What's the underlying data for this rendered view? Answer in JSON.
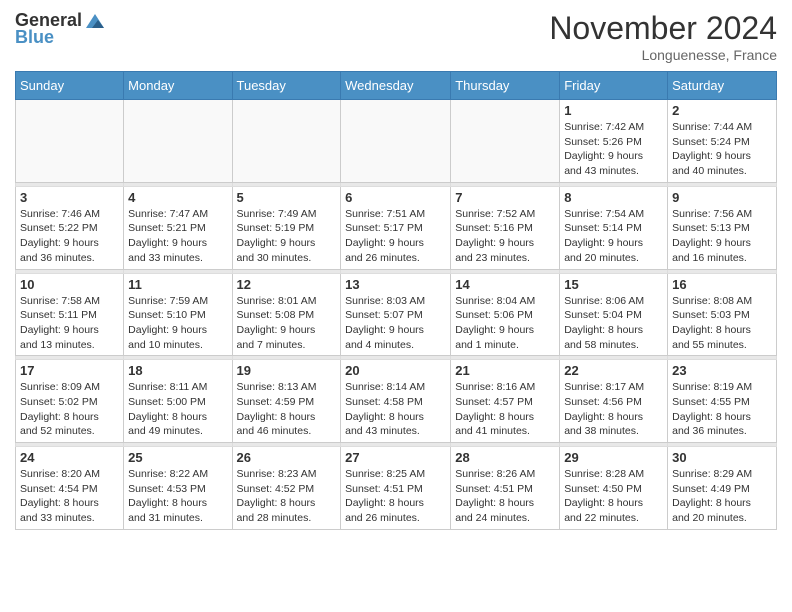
{
  "header": {
    "logo_line1": "General",
    "logo_line2": "Blue",
    "month": "November 2024",
    "location": "Longuenesse, France"
  },
  "days_of_week": [
    "Sunday",
    "Monday",
    "Tuesday",
    "Wednesday",
    "Thursday",
    "Friday",
    "Saturday"
  ],
  "weeks": [
    {
      "days": [
        {
          "num": "",
          "info": "",
          "empty": true
        },
        {
          "num": "",
          "info": "",
          "empty": true
        },
        {
          "num": "",
          "info": "",
          "empty": true
        },
        {
          "num": "",
          "info": "",
          "empty": true
        },
        {
          "num": "",
          "info": "",
          "empty": true
        },
        {
          "num": "1",
          "info": "Sunrise: 7:42 AM\nSunset: 5:26 PM\nDaylight: 9 hours\nand 43 minutes."
        },
        {
          "num": "2",
          "info": "Sunrise: 7:44 AM\nSunset: 5:24 PM\nDaylight: 9 hours\nand 40 minutes."
        }
      ]
    },
    {
      "days": [
        {
          "num": "3",
          "info": "Sunrise: 7:46 AM\nSunset: 5:22 PM\nDaylight: 9 hours\nand 36 minutes."
        },
        {
          "num": "4",
          "info": "Sunrise: 7:47 AM\nSunset: 5:21 PM\nDaylight: 9 hours\nand 33 minutes."
        },
        {
          "num": "5",
          "info": "Sunrise: 7:49 AM\nSunset: 5:19 PM\nDaylight: 9 hours\nand 30 minutes."
        },
        {
          "num": "6",
          "info": "Sunrise: 7:51 AM\nSunset: 5:17 PM\nDaylight: 9 hours\nand 26 minutes."
        },
        {
          "num": "7",
          "info": "Sunrise: 7:52 AM\nSunset: 5:16 PM\nDaylight: 9 hours\nand 23 minutes."
        },
        {
          "num": "8",
          "info": "Sunrise: 7:54 AM\nSunset: 5:14 PM\nDaylight: 9 hours\nand 20 minutes."
        },
        {
          "num": "9",
          "info": "Sunrise: 7:56 AM\nSunset: 5:13 PM\nDaylight: 9 hours\nand 16 minutes."
        }
      ]
    },
    {
      "days": [
        {
          "num": "10",
          "info": "Sunrise: 7:58 AM\nSunset: 5:11 PM\nDaylight: 9 hours\nand 13 minutes."
        },
        {
          "num": "11",
          "info": "Sunrise: 7:59 AM\nSunset: 5:10 PM\nDaylight: 9 hours\nand 10 minutes."
        },
        {
          "num": "12",
          "info": "Sunrise: 8:01 AM\nSunset: 5:08 PM\nDaylight: 9 hours\nand 7 minutes."
        },
        {
          "num": "13",
          "info": "Sunrise: 8:03 AM\nSunset: 5:07 PM\nDaylight: 9 hours\nand 4 minutes."
        },
        {
          "num": "14",
          "info": "Sunrise: 8:04 AM\nSunset: 5:06 PM\nDaylight: 9 hours\nand 1 minute."
        },
        {
          "num": "15",
          "info": "Sunrise: 8:06 AM\nSunset: 5:04 PM\nDaylight: 8 hours\nand 58 minutes."
        },
        {
          "num": "16",
          "info": "Sunrise: 8:08 AM\nSunset: 5:03 PM\nDaylight: 8 hours\nand 55 minutes."
        }
      ]
    },
    {
      "days": [
        {
          "num": "17",
          "info": "Sunrise: 8:09 AM\nSunset: 5:02 PM\nDaylight: 8 hours\nand 52 minutes."
        },
        {
          "num": "18",
          "info": "Sunrise: 8:11 AM\nSunset: 5:00 PM\nDaylight: 8 hours\nand 49 minutes."
        },
        {
          "num": "19",
          "info": "Sunrise: 8:13 AM\nSunset: 4:59 PM\nDaylight: 8 hours\nand 46 minutes."
        },
        {
          "num": "20",
          "info": "Sunrise: 8:14 AM\nSunset: 4:58 PM\nDaylight: 8 hours\nand 43 minutes."
        },
        {
          "num": "21",
          "info": "Sunrise: 8:16 AM\nSunset: 4:57 PM\nDaylight: 8 hours\nand 41 minutes."
        },
        {
          "num": "22",
          "info": "Sunrise: 8:17 AM\nSunset: 4:56 PM\nDaylight: 8 hours\nand 38 minutes."
        },
        {
          "num": "23",
          "info": "Sunrise: 8:19 AM\nSunset: 4:55 PM\nDaylight: 8 hours\nand 36 minutes."
        }
      ]
    },
    {
      "days": [
        {
          "num": "24",
          "info": "Sunrise: 8:20 AM\nSunset: 4:54 PM\nDaylight: 8 hours\nand 33 minutes."
        },
        {
          "num": "25",
          "info": "Sunrise: 8:22 AM\nSunset: 4:53 PM\nDaylight: 8 hours\nand 31 minutes."
        },
        {
          "num": "26",
          "info": "Sunrise: 8:23 AM\nSunset: 4:52 PM\nDaylight: 8 hours\nand 28 minutes."
        },
        {
          "num": "27",
          "info": "Sunrise: 8:25 AM\nSunset: 4:51 PM\nDaylight: 8 hours\nand 26 minutes."
        },
        {
          "num": "28",
          "info": "Sunrise: 8:26 AM\nSunset: 4:51 PM\nDaylight: 8 hours\nand 24 minutes."
        },
        {
          "num": "29",
          "info": "Sunrise: 8:28 AM\nSunset: 4:50 PM\nDaylight: 8 hours\nand 22 minutes."
        },
        {
          "num": "30",
          "info": "Sunrise: 8:29 AM\nSunset: 4:49 PM\nDaylight: 8 hours\nand 20 minutes."
        }
      ]
    }
  ]
}
